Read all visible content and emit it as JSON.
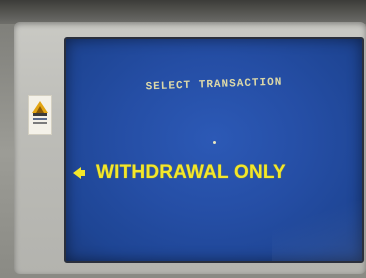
{
  "screen": {
    "title": "SELECT TRANSACTION",
    "options": [
      {
        "label": "WITHDRAWAL ONLY",
        "side": "left",
        "icon": "left-arrow-icon"
      }
    ]
  },
  "colors": {
    "screen_background": "#254ea5",
    "title_text": "#dcd8a8",
    "option_text": "#f3e72a",
    "bezel": "#bdbdb8"
  },
  "logo": {
    "icon": "bank-logo-icon"
  }
}
